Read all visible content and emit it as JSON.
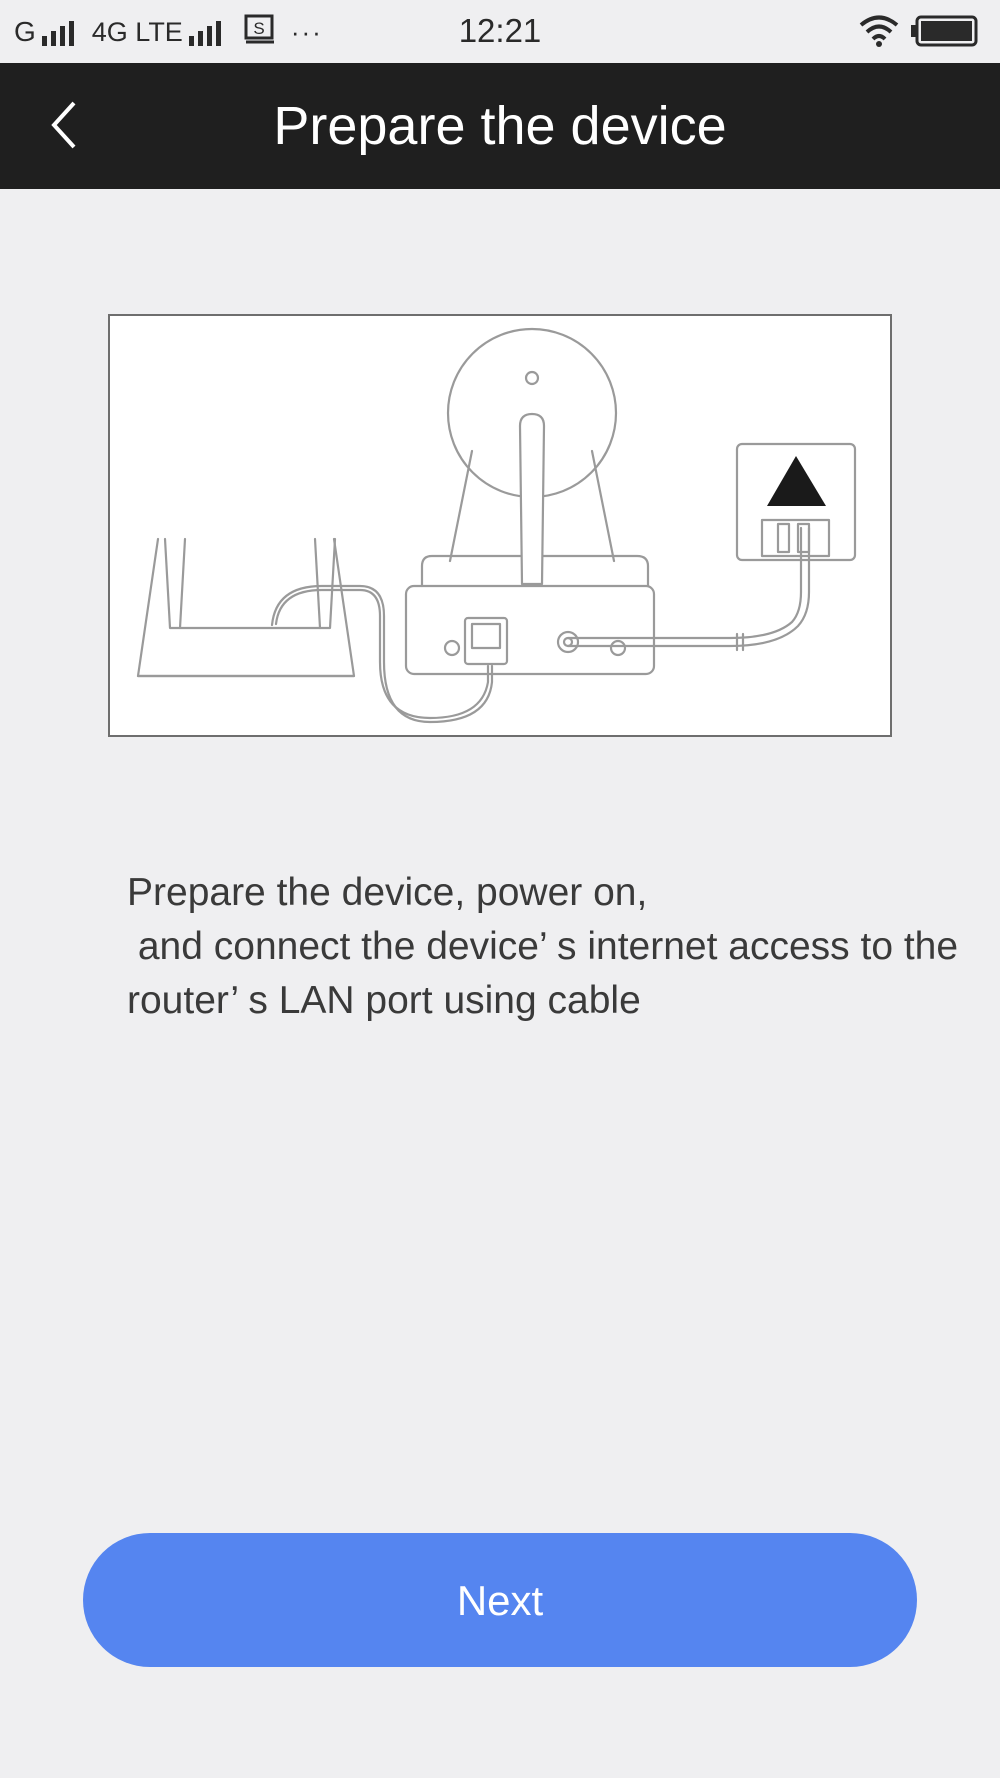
{
  "status_bar": {
    "carrier": "G",
    "network": "4G LTE",
    "sim_icon": "sim-s-icon",
    "more": "···",
    "time": "12:21",
    "wifi_icon": "wifi-icon",
    "battery_icon": "battery-full-icon"
  },
  "header": {
    "back_icon": "chevron-left-icon",
    "title": "Prepare the device"
  },
  "illustration": {
    "semantic": "router-camera-power-connection-diagram"
  },
  "instruction": {
    "text": "Prepare the device, power on,\n and connect the device’ s internet access to the router’ s LAN port using cable"
  },
  "actions": {
    "next_label": "Next"
  },
  "colors": {
    "header_bg": "#1f1f1f",
    "page_bg": "#efeff1",
    "primary_button": "#5585f0",
    "text": "#3a3a3a"
  }
}
